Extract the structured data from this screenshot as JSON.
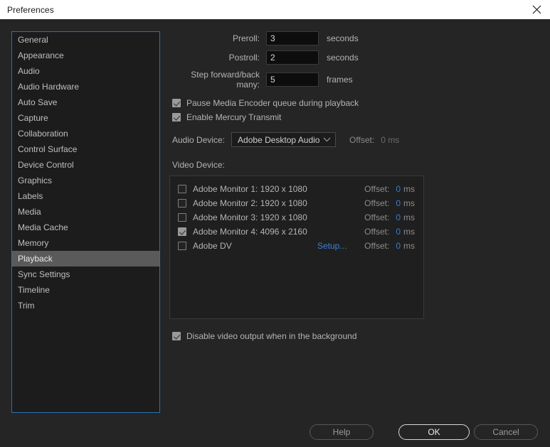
{
  "window": {
    "title": "Preferences",
    "close_icon": "close-icon"
  },
  "sidebar": {
    "items": [
      {
        "label": "General",
        "selected": false
      },
      {
        "label": "Appearance",
        "selected": false
      },
      {
        "label": "Audio",
        "selected": false
      },
      {
        "label": "Audio Hardware",
        "selected": false
      },
      {
        "label": "Auto Save",
        "selected": false
      },
      {
        "label": "Capture",
        "selected": false
      },
      {
        "label": "Collaboration",
        "selected": false
      },
      {
        "label": "Control Surface",
        "selected": false
      },
      {
        "label": "Device Control",
        "selected": false
      },
      {
        "label": "Graphics",
        "selected": false
      },
      {
        "label": "Labels",
        "selected": false
      },
      {
        "label": "Media",
        "selected": false
      },
      {
        "label": "Media Cache",
        "selected": false
      },
      {
        "label": "Memory",
        "selected": false
      },
      {
        "label": "Playback",
        "selected": true
      },
      {
        "label": "Sync Settings",
        "selected": false
      },
      {
        "label": "Timeline",
        "selected": false
      },
      {
        "label": "Trim",
        "selected": false
      }
    ]
  },
  "playback": {
    "preroll": {
      "label": "Preroll:",
      "value": "3",
      "unit": "seconds"
    },
    "postroll": {
      "label": "Postroll:",
      "value": "2",
      "unit": "seconds"
    },
    "step": {
      "label": "Step forward/back many:",
      "value": "5",
      "unit": "frames"
    },
    "pause_media_encoder": {
      "label": "Pause Media Encoder queue during playback",
      "checked": true
    },
    "enable_mercury": {
      "label": "Enable Mercury Transmit",
      "checked": true
    },
    "audio_device": {
      "label": "Audio Device:",
      "selected": "Adobe Desktop Audio",
      "chevron_icon": "chevron-down-icon",
      "offset_label": "Offset:",
      "offset_value": "0 ms"
    },
    "video_device": {
      "title": "Video Device:",
      "offset_label": "Offset:",
      "offset_unit": "ms",
      "setup_label": "Setup...",
      "rows": [
        {
          "name": "Adobe Monitor 1: 1920 x 1080",
          "checked": false,
          "setup": false,
          "offset": "0"
        },
        {
          "name": "Adobe Monitor 2: 1920 x 1080",
          "checked": false,
          "setup": false,
          "offset": "0"
        },
        {
          "name": "Adobe Monitor 3: 1920 x 1080",
          "checked": false,
          "setup": false,
          "offset": "0"
        },
        {
          "name": "Adobe Monitor 4: 4096 x 2160",
          "checked": true,
          "setup": false,
          "offset": "0"
        },
        {
          "name": "Adobe DV",
          "checked": false,
          "setup": true,
          "offset": "0"
        }
      ]
    },
    "disable_video_output": {
      "label": "Disable video output when in the background",
      "checked": true
    }
  },
  "footer": {
    "help_label": "Help",
    "ok_label": "OK",
    "cancel_label": "Cancel"
  },
  "colors": {
    "accent_blue": "#2a7fd4",
    "sidebar_border": "#2d6fb5",
    "selected_row": "#5a5a5a"
  }
}
